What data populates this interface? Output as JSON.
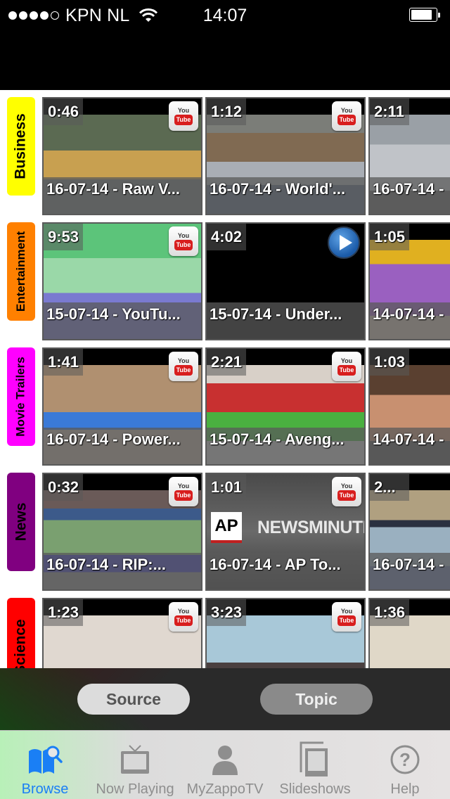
{
  "status_bar": {
    "signal_bars_filled": 4,
    "signal_bars_total": 5,
    "carrier": "KPN NL",
    "time": "14:07",
    "battery_level": 0.85
  },
  "categories": [
    {
      "label": "Business",
      "color": "#ffff00",
      "videos": [
        {
          "duration": "0:46",
          "title": "16-07-14 - Raw V...",
          "source": "youtube",
          "thumb": "street-flood"
        },
        {
          "duration": "1:12",
          "title": "16-07-14 - World'...",
          "source": "youtube",
          "thumb": "jet-plane"
        },
        {
          "duration": "2:11",
          "title": "16-07-14 - ",
          "source": "youtube",
          "thumb": "silver-car"
        }
      ]
    },
    {
      "label": "Entertainment",
      "color": "#ff8000",
      "videos": [
        {
          "duration": "9:53",
          "title": "15-07-14 - YouTu...",
          "source": "youtube",
          "thumb": "green-screen-couple"
        },
        {
          "duration": "4:02",
          "title": "15-07-14 - Under...",
          "source": "play",
          "thumb": "black"
        },
        {
          "duration": "1:05",
          "title": "14-07-14 - ",
          "source": "youtube",
          "thumb": "cartoon-granny"
        }
      ]
    },
    {
      "label": "Movie Trailers",
      "color": "#ff00ff",
      "videos": [
        {
          "duration": "1:41",
          "title": "16-07-14 - Power...",
          "source": "youtube",
          "thumb": "group-cast"
        },
        {
          "duration": "2:21",
          "title": "15-07-14 - Aveng...",
          "source": "youtube",
          "thumb": "hulk-hands"
        },
        {
          "duration": "1:03",
          "title": "14-07-14 - ",
          "source": "youtube",
          "thumb": "man-bookshelf"
        }
      ]
    },
    {
      "label": "News",
      "color": "#800080",
      "videos": [
        {
          "duration": "0:32",
          "title": "16-07-14 - RIP:...",
          "source": "youtube",
          "thumb": "flowers-metro"
        },
        {
          "duration": "1:01",
          "title": "16-07-14 - AP To...",
          "source": "youtube",
          "thumb": "ap-newsminute",
          "overlay_text": "NEWSMINUTE",
          "logo_text": "AP"
        },
        {
          "duration": "2...",
          "title": "16-07-14 - ",
          "source": "youtube",
          "thumb": "news-split"
        }
      ]
    },
    {
      "label": "Science",
      "color": "#ff0000",
      "videos": [
        {
          "duration": "1:23",
          "title": "",
          "source": "youtube",
          "thumb": "man-couch"
        },
        {
          "duration": "3:23",
          "title": "",
          "source": "youtube",
          "thumb": "two-men"
        },
        {
          "duration": "1:36",
          "title": "",
          "source": "youtube",
          "thumb": "room"
        }
      ]
    }
  ],
  "youtube_badge": {
    "top": "You",
    "bottom": "Tube"
  },
  "segment": {
    "source_label": "Source",
    "topic_label": "Topic",
    "selected": "Topic"
  },
  "tabs": [
    {
      "label": "Browse",
      "icon": "browse-book-search-icon",
      "active": true
    },
    {
      "label": "Now Playing",
      "icon": "tv-icon",
      "active": false
    },
    {
      "label": "MyZappoTV",
      "icon": "person-icon",
      "active": false
    },
    {
      "label": "Slideshows",
      "icon": "slides-icon",
      "active": false
    },
    {
      "label": "Help",
      "icon": "help-icon",
      "active": false
    }
  ],
  "colors": {
    "tab_active": "#1a7ff5",
    "tab_inactive": "#8e8e8e"
  }
}
